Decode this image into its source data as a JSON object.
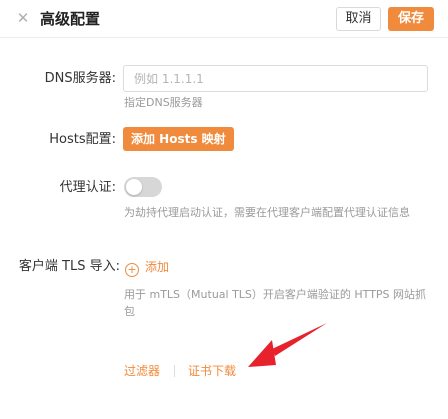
{
  "header": {
    "close_icon": "close-icon",
    "title": "高级配置",
    "cancel_label": "取消",
    "save_label": "保存"
  },
  "colors": {
    "accent": "#f08a3c",
    "arrow": "#e8222c",
    "toggle_off": "#d7d7d7",
    "hint_text": "#9a9a9a"
  },
  "dns": {
    "label": "DNS服务器:",
    "placeholder": "例如 1.1.1.1",
    "value": "",
    "hint": "指定DNS服务器"
  },
  "hosts": {
    "label": "Hosts配置:",
    "button_label": "添加 Hosts 映射"
  },
  "proxy_auth": {
    "label": "代理认证:",
    "enabled": false,
    "hint": "为劫持代理启动认证，需要在代理客户端配置代理认证信息"
  },
  "client_tls": {
    "label": "客户端 TLS 导入:",
    "add_label": "添加",
    "add_icon": "plus-circle-icon",
    "hint": "用于 mTLS（Mutual TLS）开启客户端验证的 HTTPS 网站抓包"
  },
  "footer_links": {
    "filter_label": "过滤器",
    "cert_download_label": "证书下载"
  },
  "annotation": {
    "type": "arrow-icon",
    "points_to": "证书下载"
  }
}
